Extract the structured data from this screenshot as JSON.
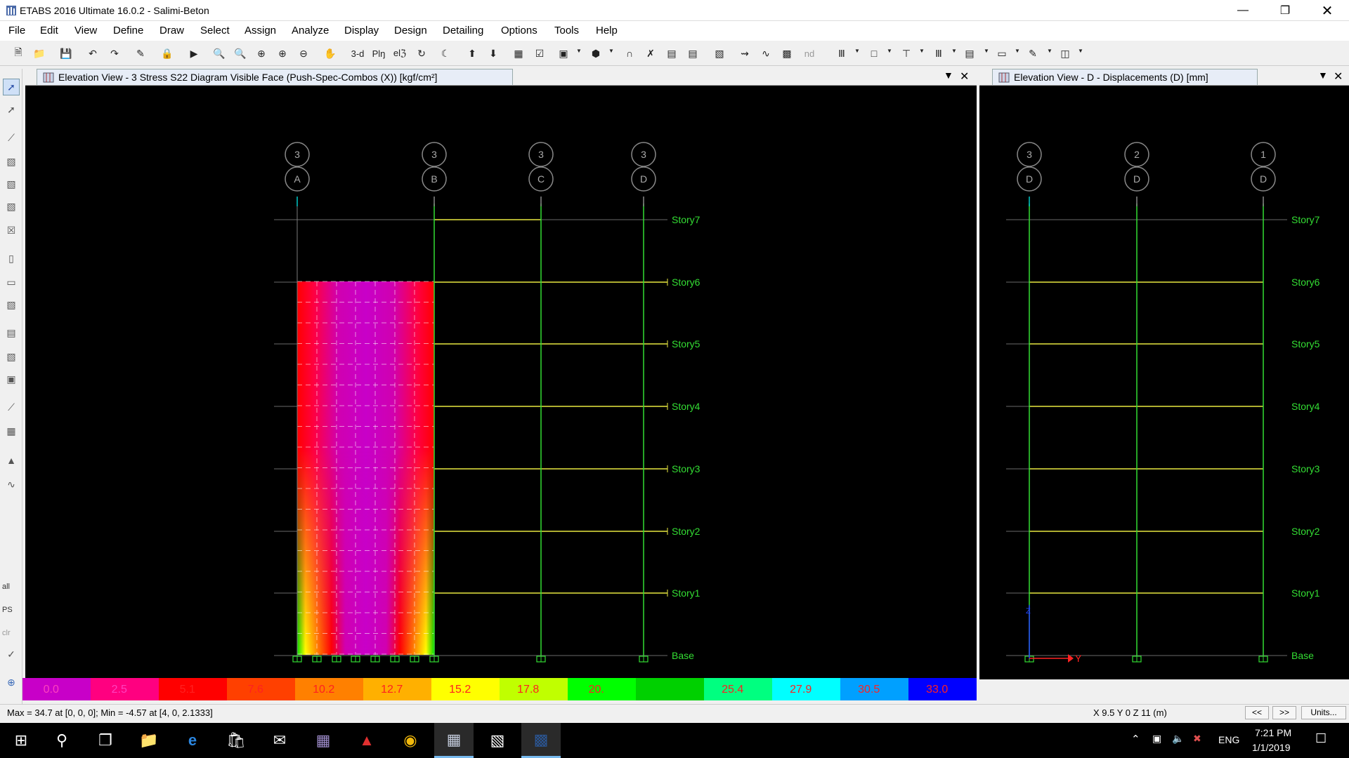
{
  "window": {
    "title": "ETABS 2016 Ultimate 16.0.2 - Salimi-Beton"
  },
  "menu": [
    "File",
    "Edit",
    "View",
    "Define",
    "Draw",
    "Select",
    "Assign",
    "Analyze",
    "Display",
    "Design",
    "Detailing",
    "Options",
    "Tools",
    "Help"
  ],
  "toolbar": {
    "label_3d": "3-d",
    "label_plan": "Plŋ",
    "label_elev": "elℨ",
    "label_nd": "nd"
  },
  "sidebar": {
    "all": "all",
    "ps": "PS",
    "clr": "clr"
  },
  "left_view": {
    "tab_title": "Elevation View - 3   Stress S22 Diagram  Visible Face   (Push-Spec-Combos (X))  [kgf/cm²]",
    "grid_bubbles": [
      [
        "3",
        "A"
      ],
      [
        "3",
        "B"
      ],
      [
        "3",
        "C"
      ],
      [
        "3",
        "D"
      ]
    ],
    "stories": [
      "Story7",
      "Story6",
      "Story5",
      "Story4",
      "Story3",
      "Story2",
      "Story1",
      "Base"
    ]
  },
  "right_view": {
    "tab_title": "Elevation View - D   - Displacements (D)  [mm]",
    "grid_bubbles": [
      [
        "3",
        "D"
      ],
      [
        "2",
        "D"
      ],
      [
        "1",
        "D"
      ]
    ],
    "stories": [
      "Story7",
      "Story6",
      "Story5",
      "Story4",
      "Story3",
      "Story2",
      "Story1",
      "Base"
    ],
    "axis_y": "Y",
    "axis_z": "Z"
  },
  "legend": {
    "labels": [
      "0.0",
      "2.5",
      "5.1",
      "7.6",
      "10.2",
      "12.7",
      "15.2",
      "17.8",
      "20.",
      "",
      "25.4",
      "27.9",
      "30.5",
      "33.0"
    ],
    "colors": [
      "#c800c8",
      "#ff0080",
      "#ff0000",
      "#ff4000",
      "#ff8000",
      "#ffb000",
      "#ffff00",
      "#c0ff00",
      "#00ff00",
      "#00d000",
      "#00ff80",
      "#00ffff",
      "#00a0ff",
      "#0000ff"
    ]
  },
  "status": {
    "minmax": "Max = 34.7 at [0, 0, 0];  Min = -4.57 at [4, 0, 2.1333]",
    "coords": "X 9.5  Y 0  Z 11 (m)",
    "prev": "<<",
    "next": ">>",
    "units": "Units..."
  },
  "taskbar": {
    "lang": "ENG",
    "time": "7:21 PM",
    "date": "1/1/2019"
  }
}
